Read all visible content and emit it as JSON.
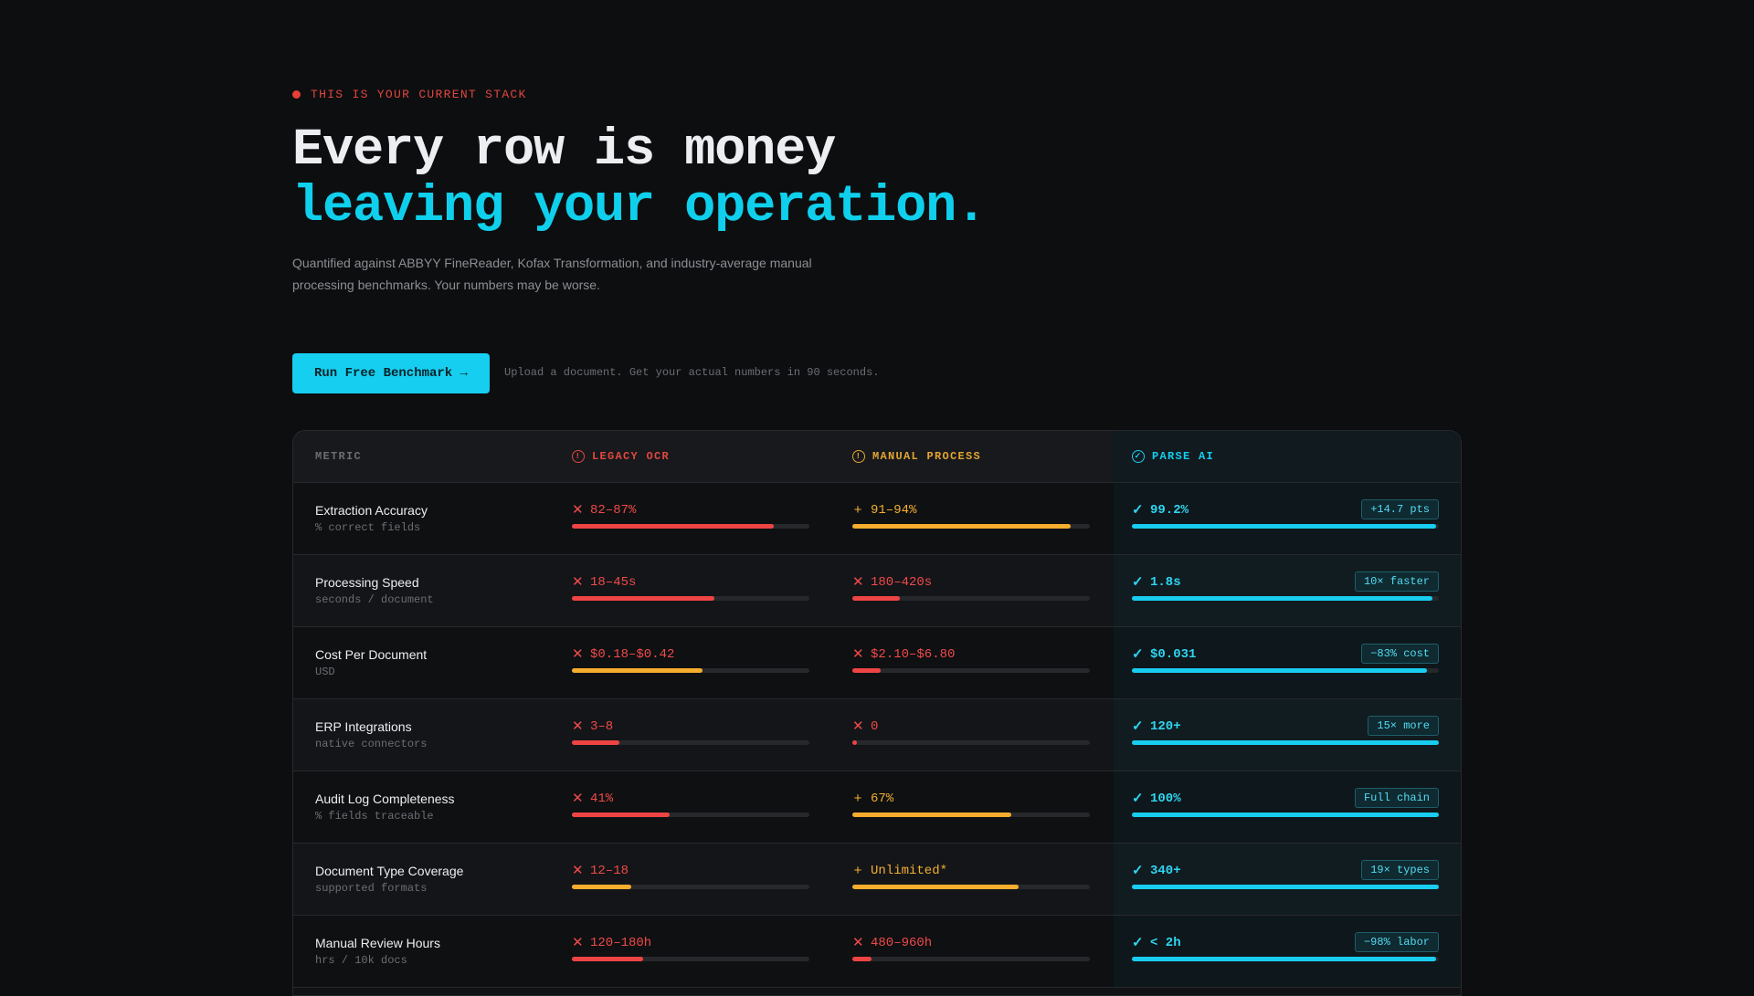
{
  "hero": {
    "eyebrow": "THIS IS YOUR CURRENT STACK",
    "headline_line1": "Every row is money",
    "headline_line2": "leaving your operation.",
    "subtext": "Quantified against ABBYY FineReader, Kofax Transformation, and industry-average manual processing benchmarks. Your numbers may be worse.",
    "cta_label": "Run Free Benchmark →",
    "cta_note": "Upload a document. Get your actual numbers in 90 seconds."
  },
  "table": {
    "headers": {
      "metric": "METRIC",
      "legacy": "LEGACY OCR",
      "manual": "MANUAL PROCESS",
      "parse": "PARSE AI"
    },
    "rows": [
      {
        "name": "Extraction Accuracy",
        "sub": "% correct fields",
        "legacy": {
          "mark": "✕",
          "tone": "red",
          "value": "82–87%",
          "bar": 0.85,
          "bar_tone": "red"
        },
        "manual": {
          "mark": "+",
          "tone": "amber",
          "value": "91–94%",
          "bar": 0.92,
          "bar_tone": "amber"
        },
        "parse": {
          "mark": "✓",
          "value": "99.2%",
          "bar": 0.99,
          "badge": "+14.7 pts"
        }
      },
      {
        "name": "Processing Speed",
        "sub": "seconds / document",
        "legacy": {
          "mark": "✕",
          "tone": "red",
          "value": "18–45s",
          "bar": 0.6,
          "bar_tone": "red"
        },
        "manual": {
          "mark": "✕",
          "tone": "red",
          "value": "180–420s",
          "bar": 0.2,
          "bar_tone": "red"
        },
        "parse": {
          "mark": "✓",
          "value": "1.8s",
          "bar": 0.98,
          "badge": "10× faster"
        }
      },
      {
        "name": "Cost Per Document",
        "sub": "USD",
        "legacy": {
          "mark": "✕",
          "tone": "red",
          "value": "$0.18–$0.42",
          "bar": 0.55,
          "bar_tone": "amber"
        },
        "manual": {
          "mark": "✕",
          "tone": "red",
          "value": "$2.10–$6.80",
          "bar": 0.12,
          "bar_tone": "red"
        },
        "parse": {
          "mark": "✓",
          "value": "$0.031",
          "bar": 0.96,
          "badge": "−83% cost"
        }
      },
      {
        "name": "ERP Integrations",
        "sub": "native connectors",
        "legacy": {
          "mark": "✕",
          "tone": "red",
          "value": "3–8",
          "bar": 0.2,
          "bar_tone": "red"
        },
        "manual": {
          "mark": "✕",
          "tone": "red",
          "value": "0",
          "bar": 0.02,
          "bar_tone": "red"
        },
        "parse": {
          "mark": "✓",
          "value": "120+",
          "bar": 1.0,
          "badge": "15× more"
        }
      },
      {
        "name": "Audit Log Completeness",
        "sub": "% fields traceable",
        "legacy": {
          "mark": "✕",
          "tone": "red",
          "value": "41%",
          "bar": 0.41,
          "bar_tone": "red"
        },
        "manual": {
          "mark": "+",
          "tone": "amber",
          "value": "67%",
          "bar": 0.67,
          "bar_tone": "amber"
        },
        "parse": {
          "mark": "✓",
          "value": "100%",
          "bar": 1.0,
          "badge": "Full chain"
        }
      },
      {
        "name": "Document Type Coverage",
        "sub": "supported formats",
        "legacy": {
          "mark": "✕",
          "tone": "red",
          "value": "12–18",
          "bar": 0.25,
          "bar_tone": "amber"
        },
        "manual": {
          "mark": "+",
          "tone": "amber",
          "value": "Unlimited*",
          "bar": 0.7,
          "bar_tone": "amber"
        },
        "parse": {
          "mark": "✓",
          "value": "340+",
          "bar": 1.0,
          "badge": "19× types"
        }
      },
      {
        "name": "Manual Review Hours",
        "sub": "hrs / 10k docs",
        "legacy": {
          "mark": "✕",
          "tone": "red",
          "value": "120–180h",
          "bar": 0.3,
          "bar_tone": "red"
        },
        "manual": {
          "mark": "✕",
          "tone": "red",
          "value": "480–960h",
          "bar": 0.08,
          "bar_tone": "red"
        },
        "parse": {
          "mark": "✓",
          "value": "< 2h",
          "bar": 0.99,
          "badge": "−98% labor"
        }
      }
    ]
  },
  "colors": {
    "accent": "#16cff0",
    "danger": "#ef4444",
    "warning": "#f5ad2e",
    "background": "#0d0e10"
  }
}
